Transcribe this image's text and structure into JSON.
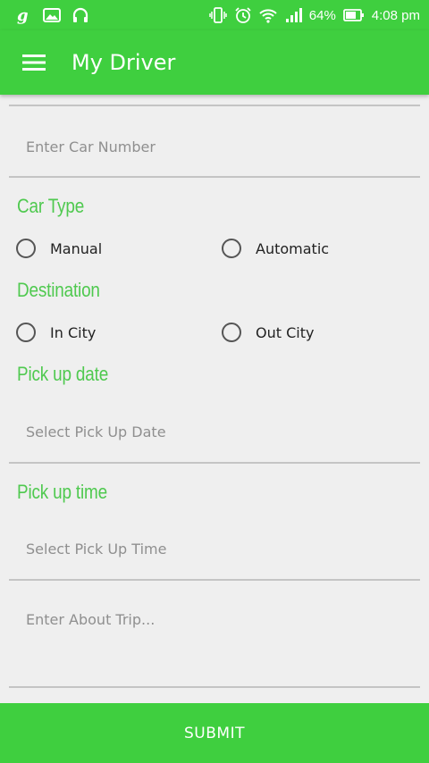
{
  "status_bar": {
    "battery": "64%",
    "time": "4:08 pm",
    "left_icons": [
      "g-icon",
      "image-icon",
      "headphones-icon"
    ],
    "right_icons": [
      "vibrate-icon",
      "alarm-icon",
      "wifi-icon",
      "signal-icon",
      "battery-icon"
    ]
  },
  "app_bar": {
    "title": "My Driver",
    "menu_icon": "hamburger-menu-icon"
  },
  "form": {
    "car_number_placeholder": "Enter Car Number",
    "car_type": {
      "label": "Car Type",
      "options": [
        "Manual",
        "Automatic"
      ],
      "selected": null
    },
    "destination": {
      "label": "Destination",
      "options": [
        "In City",
        "Out City"
      ],
      "selected": null
    },
    "pickup_date": {
      "label": "Pick up date",
      "placeholder": "Select Pick Up Date"
    },
    "pickup_time": {
      "label": "Pick up time",
      "placeholder": "Select Pick Up Time"
    },
    "about_trip_placeholder": "Enter About Trip..."
  },
  "submit_label": "SUBMIT",
  "colors": {
    "primary": "#3fcf3f",
    "label_green": "#4fc94f",
    "background": "#efefef",
    "divider": "#c4c4c4",
    "placeholder": "#8f8f8f"
  }
}
